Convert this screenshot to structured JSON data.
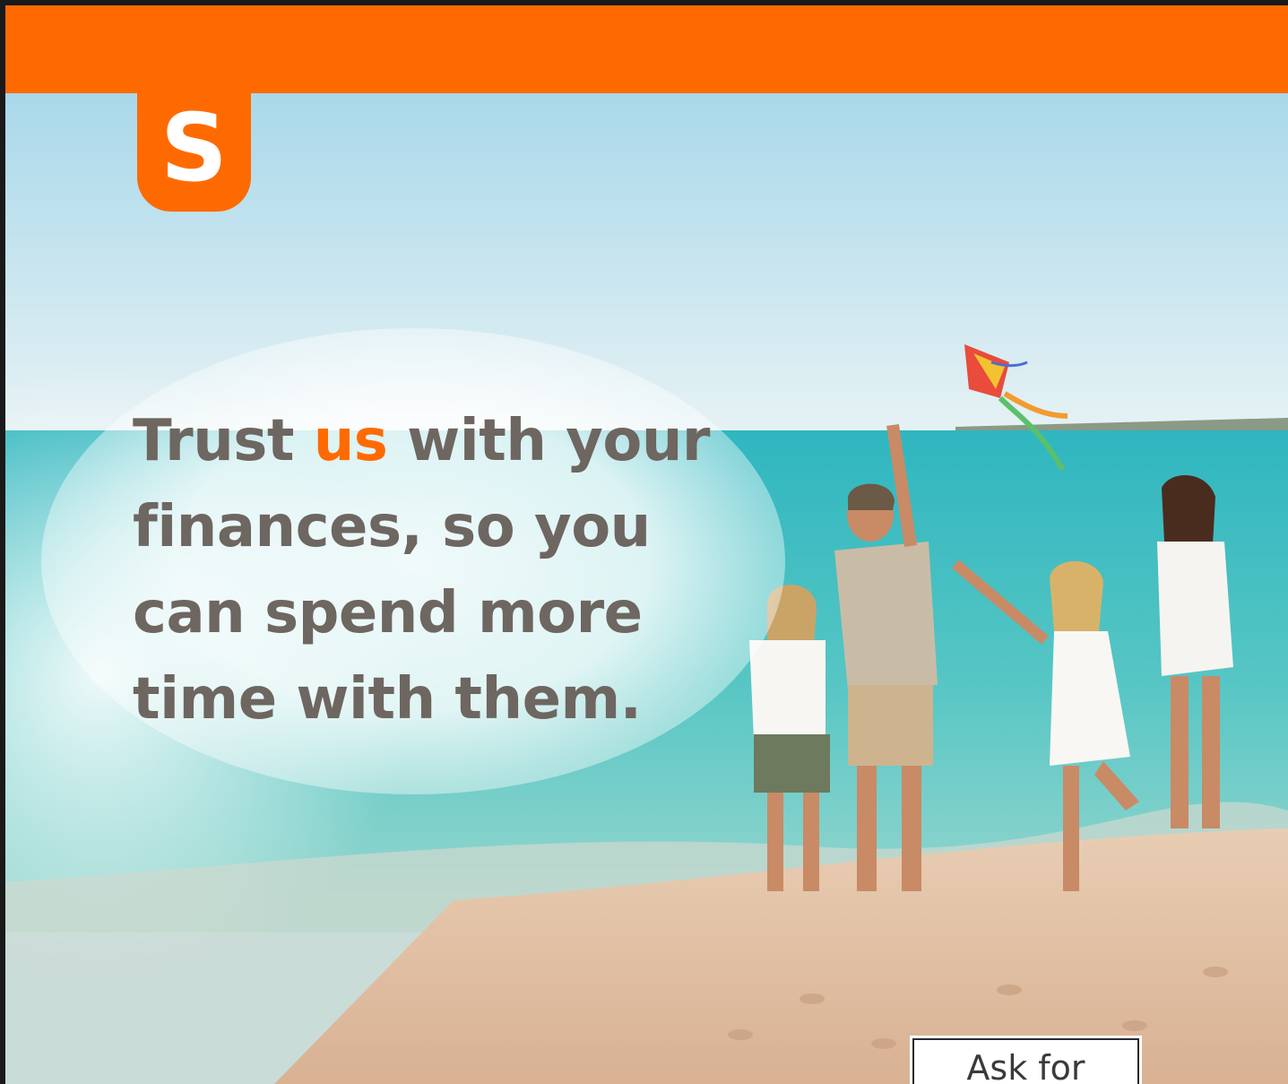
{
  "logo": {
    "letter": "S",
    "color": "#ff6a00"
  },
  "headline": {
    "part1": "Trust ",
    "highlight": "us",
    "part2": " with your",
    "line2": "finances, so you",
    "line3": "can spend more",
    "line4": "time with them."
  },
  "cta": {
    "label": "Ask for"
  },
  "colors": {
    "brand": "#ff6a00",
    "headline_text": "#6e6660"
  },
  "photo": {
    "subject": "family-flying-kite-on-beach"
  }
}
